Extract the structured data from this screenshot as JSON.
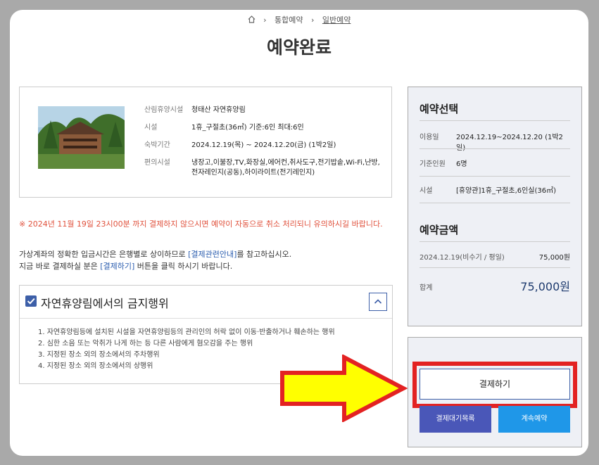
{
  "breadcrumb": {
    "items": [
      "통합예약",
      "일반예약"
    ]
  },
  "page_title": "예약완료",
  "reservation": {
    "rows": [
      {
        "key": "산림휴양시설",
        "value": "청태산 자연휴양림"
      },
      {
        "key": "시설",
        "value": "1휴_구절초(36㎡) 기준:6인 최대:6인"
      },
      {
        "key": "숙박기간",
        "value": "2024.12.19(목) ~ 2024.12.20(금) (1박2일)"
      },
      {
        "key": "편의시설",
        "value": "냉장고,이불장,TV,화장실,에어컨,취사도구,전기밥솥,Wi-Fi,난방,전자레인지(공동),하이라이트(전기레인지)"
      }
    ]
  },
  "notice": "※ 2024년 11월 19일 23시00분 까지 결제하지 않으시면 예약이 자동으로 취소 처리되니 유의하시길 바랍니다.",
  "guide": {
    "line1_a": "가상계좌의 정확한 입금시간은 은행별로 상이하므로 ",
    "line1_link": "[결제관련안내]",
    "line1_b": "를 참고하십시오.",
    "line2_a": "지금 바로 결제하실 분은 ",
    "line2_link": "[결제하기]",
    "line2_b": " 버튼을 클릭 하시기 바랍니다."
  },
  "prohibited": {
    "title": "자연휴양림에서의 금지행위",
    "items": [
      "1. 자연휴양림등에 설치된 시설을 자연휴양림등의 관리인의 허락 없이 이동·반출하거나 훼손하는 행위",
      "2. 심한 소음 또는 악취가 나게 하는 등 다른 사람에게 혐오감을 주는 행위",
      "3. 지정된 장소 외의 장소에서의 주차행위",
      "4. 지정된 장소 외의 장소에서의 상행위"
    ]
  },
  "selection": {
    "title": "예약선택",
    "rows": [
      {
        "key": "이용일",
        "value": "2024.12.19~2024.12.20 (1박2일)"
      },
      {
        "key": "기준인원",
        "value": "6명"
      },
      {
        "key": "시설",
        "value": "[휴양관]1휴_구절초,6인실(36㎡)"
      }
    ]
  },
  "amount": {
    "title": "예약금액",
    "line_label": "2024.12.19(비수기 / 평일)",
    "line_value": "75,000원",
    "total_label": "합계",
    "total_value": "75,000원"
  },
  "actions": {
    "pay": "결제하기",
    "waitlist": "결제대기목록",
    "continue": "계속예약"
  },
  "colors": {
    "accent": "#3d5fa8",
    "notice": "#e0513c",
    "highlight": "#e32222",
    "arrow": "#ffff00"
  }
}
